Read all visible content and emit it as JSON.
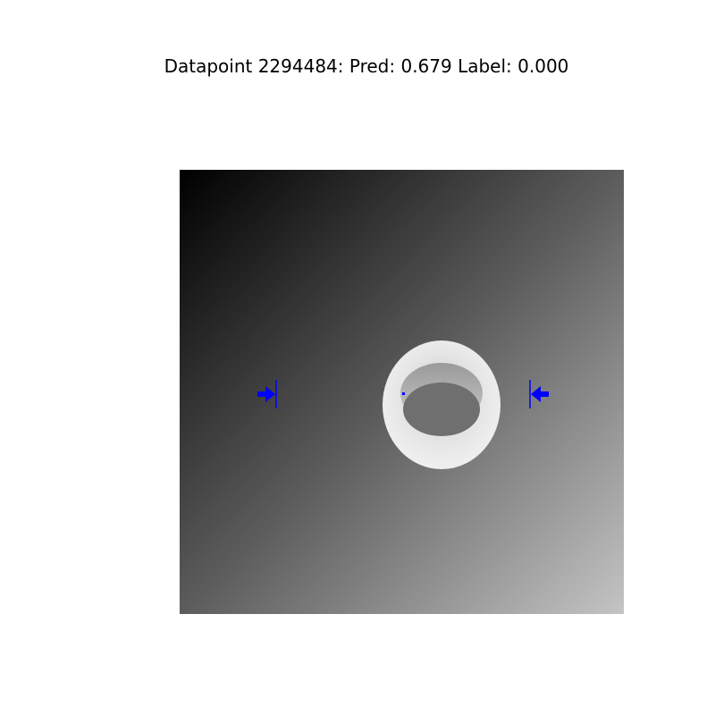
{
  "figure": {
    "title": "Datapoint 2294484: Pred: 0.679 Label: 0.000"
  },
  "image": {
    "background": "grayscale-depth-gradient",
    "object": "ring",
    "object_color": "#e8e8e8",
    "marker_color": "#0000ff",
    "markers": [
      "left-arrow-marker",
      "right-arrow-marker",
      "center-dot-marker"
    ]
  }
}
